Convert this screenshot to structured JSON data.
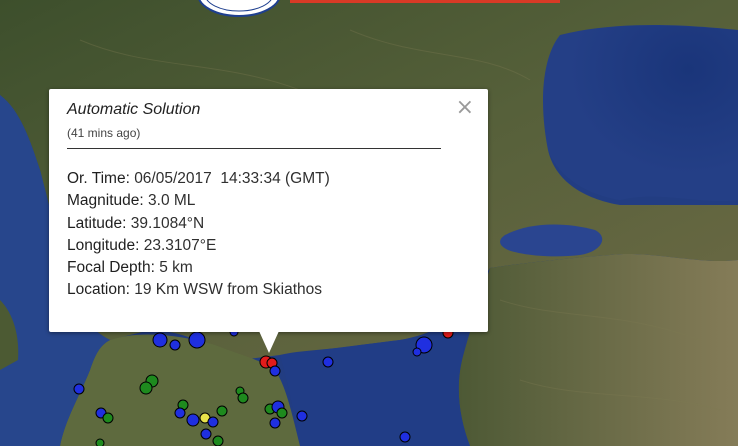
{
  "popup": {
    "title": "Automatic Solution",
    "ago": "(41 mins ago)",
    "close_glyph": "×",
    "fields": [
      {
        "label": "Or. Time:",
        "value": "06/05/2017  14:33:34 (GMT)"
      },
      {
        "label": "Magnitude:",
        "value": "3.0 ML"
      },
      {
        "label": "Latitude:",
        "value": "39.1084°N"
      },
      {
        "label": "Longitude:",
        "value": "23.3107°E"
      },
      {
        "label": "Focal Depth:",
        "value": "5 km"
      },
      {
        "label": "Location:",
        "value": "19 Km WSW from Skiathos"
      }
    ]
  },
  "markers": {
    "colors": {
      "blue": "#1f2fe0",
      "green": "#1e8a1e",
      "red": "#e21b1b",
      "yellow": "#e9e34a"
    }
  }
}
